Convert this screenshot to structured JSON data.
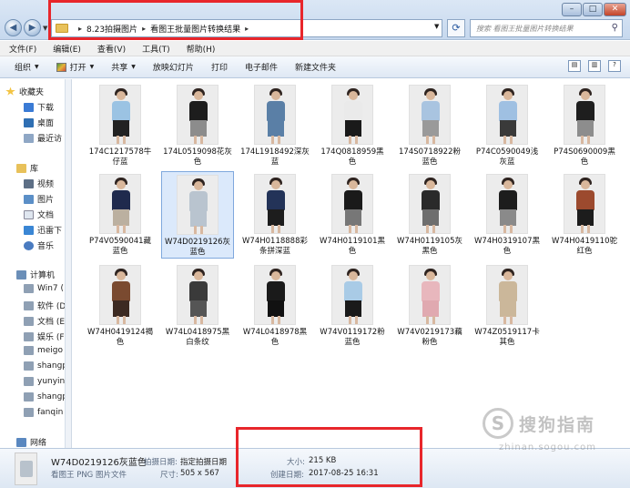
{
  "address": {
    "crumbs": [
      "8.23拍摄图片",
      "看图王批量图片转换结果"
    ]
  },
  "search": {
    "placeholder": "搜索 看图王批量图片转换结果"
  },
  "menu": [
    "文件(F)",
    "编辑(E)",
    "查看(V)",
    "工具(T)",
    "帮助(H)"
  ],
  "toolbar": {
    "organize": "组织",
    "open": "打开",
    "share": "共享",
    "slideshow": "放映幻灯片",
    "print": "打印",
    "email": "电子邮件",
    "new_folder": "新建文件夹"
  },
  "nav": {
    "favorites": "收藏夹",
    "fav_items": [
      "下载",
      "桌面",
      "最近访"
    ],
    "libraries": "库",
    "lib_items": [
      "视频",
      "图片",
      "文档",
      "迅雷下",
      "音乐"
    ],
    "computer": "计算机",
    "drives": [
      "Win7 (",
      "软件 (D",
      "文档 (E",
      "娱乐 (F",
      "meigo",
      "shangp",
      "yunying",
      "shangp",
      "fanqin"
    ],
    "network": "网络"
  },
  "files": [
    {
      "name": "174C1217578牛仔蓝",
      "top": "#9bc3e3",
      "bottom": "#222222"
    },
    {
      "name": "174L0519098花灰色",
      "top": "#1d1d1d",
      "bottom": "#8c8c8c"
    },
    {
      "name": "174L1918492深灰蓝",
      "top": "#5a7fa6",
      "bottom": "#5a7fa6"
    },
    {
      "name": "174Q0818959黑色",
      "top": "#eaeaea",
      "bottom": "#1a1a1a"
    },
    {
      "name": "174S0718922粉蓝色",
      "top": "#a9c4e0",
      "bottom": "#9a9a9a"
    },
    {
      "name": "P74C0590049浅灰蓝",
      "top": "#9fc0e2",
      "bottom": "#3a3a3a"
    },
    {
      "name": "P74S0690009黑色",
      "top": "#1e1e1e",
      "bottom": "#8d8d8d"
    },
    {
      "name": "P74V0590041藏蓝色",
      "top": "#1f2a4d",
      "bottom": "#bbb0a0"
    },
    {
      "name": "W74D0219126灰蓝色",
      "top": "#b9c4cf",
      "bottom": "#b9c4cf"
    },
    {
      "name": "W74H0118888彩条拼深蓝",
      "top": "#233358",
      "bottom": "#1d1d1d"
    },
    {
      "name": "W74H0119101黑色",
      "top": "#1a1a1a",
      "bottom": "#777777"
    },
    {
      "name": "W74H0119105灰黑色",
      "top": "#2a2a2a",
      "bottom": "#6e6e6e"
    },
    {
      "name": "W74H0319107黑色",
      "top": "#1d1d1d",
      "bottom": "#8a8a8a"
    },
    {
      "name": "W74H0419110驼红色",
      "top": "#9c4a2e",
      "bottom": "#1c1c1c"
    },
    {
      "name": "W74H0419124褐色",
      "top": "#7a4a30",
      "bottom": "#3c2a22"
    },
    {
      "name": "W74L0418975黑白条纹",
      "top": "#3a3a3a",
      "bottom": "#555555"
    },
    {
      "name": "W74L0418978黑色",
      "top": "#1a1a1a",
      "bottom": "#111111"
    },
    {
      "name": "W74V0119172粉蓝色",
      "top": "#a9cbe6",
      "bottom": "#1a1a1a"
    },
    {
      "name": "W74V0219173藕粉色",
      "top": "#e8b7bd",
      "bottom": "#e0a9b0"
    },
    {
      "name": "W74Z0519117卡其色",
      "top": "#cbb79a",
      "bottom": "#cbb79a"
    }
  ],
  "details": {
    "name": "W74D0219126灰蓝色",
    "type": "看图王 PNG 图片文件",
    "shot_label": "拍摄日期:",
    "shot_value": "指定拍摄日期",
    "dim_label": "尺寸:",
    "dim_value": "505 x 567",
    "size_label": "大小:",
    "size_value": "215 KB",
    "created_label": "创建日期:",
    "created_value": "2017-08-25 16:31"
  },
  "watermark": {
    "text": "搜狗指南",
    "url": "zhinan.sogou.com"
  },
  "colors": {
    "highlight": "#e8262b",
    "selection": "#dbe9fb"
  }
}
